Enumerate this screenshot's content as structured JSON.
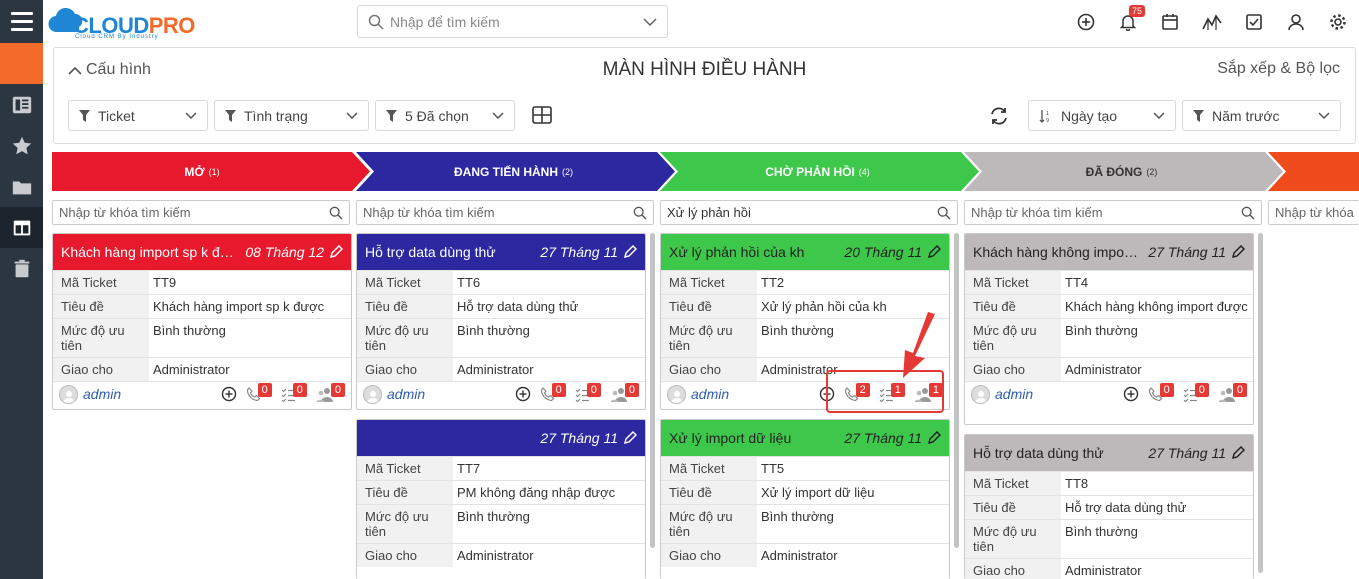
{
  "app": {
    "brand_cloud": "CLOUD",
    "brand_pro": "PRO",
    "tagline": "Cloud CRM By Industry",
    "search_placeholder": "Nhập để tìm kiếm",
    "notification_count": "75"
  },
  "config": {
    "config_label": "Cấu hình",
    "title": "MÀN HÌNH ĐIỀU HÀNH",
    "sort_filter_label": "Sắp xếp & Bộ lọc",
    "filters": {
      "module": "Ticket",
      "status": "Tình trạng",
      "selected": "5 Đã chọn",
      "sort_by": "Ngày tạo",
      "period": "Năm trước"
    }
  },
  "stages": [
    {
      "label": "MỞ",
      "count": "(1)",
      "color": "#e8192c"
    },
    {
      "label": "ĐANG TIẾN HÀNH",
      "count": "(2)",
      "color": "#2b28a0"
    },
    {
      "label": "CHỜ PHẢN HỒI",
      "count": "(4)",
      "color": "#3ec84b"
    },
    {
      "label": "ĐÃ ĐÓNG",
      "count": "(2)",
      "color": "#bdb8b9"
    },
    {
      "label": "",
      "count": "",
      "color": "#f04b1c"
    }
  ],
  "column_search": {
    "placeholder": "Nhập từ khóa tìm kiếm",
    "value_col3": "Xử lý phản hồi",
    "placeholder_col5": "Nhập từ khóa"
  },
  "field_labels": {
    "ticket_no": "Mã Ticket",
    "title": "Tiêu đề",
    "priority": "Mức độ ưu tiên",
    "assignee": "Giao cho"
  },
  "cards": {
    "c1": {
      "head": "Khách hàng import sp k đư...",
      "date": "08 Tháng 12",
      "ticket_no": "TT9",
      "title": "Khách hàng import sp k được",
      "priority": "Bình thường",
      "assignee": "Administrator",
      "user": "admin",
      "calls": "0",
      "tasks": "0",
      "contacts": "0"
    },
    "c2": {
      "head": "Hỗ trợ data dùng thử",
      "date": "27 Tháng 11",
      "ticket_no": "TT6",
      "title": "Hỗ trợ data dùng thử",
      "priority": "Bình thường",
      "assignee": "Administrator",
      "user": "admin",
      "calls": "0",
      "tasks": "0",
      "contacts": "0"
    },
    "c3": {
      "head": "",
      "date": "27 Tháng 11",
      "ticket_no": "TT7",
      "title": "PM không đăng nhập được",
      "priority": "Bình thường",
      "assignee": "Administrator"
    },
    "c4": {
      "head": "Xử lý phản hồi của kh",
      "date": "20 Tháng 11",
      "ticket_no": "TT2",
      "title": "Xử lý phản hồi của kh",
      "priority": "Bình thường",
      "assignee": "Administrator",
      "user": "admin",
      "calls": "2",
      "tasks": "1",
      "contacts": "1"
    },
    "c5": {
      "head": "Xử lý import dữ liệu",
      "date": "27 Tháng 11",
      "ticket_no": "TT5",
      "title": "Xử lý import dữ liệu",
      "priority": "Bình thường",
      "assignee": "Administrator"
    },
    "c6": {
      "head": "Khách hàng không import...",
      "date": "27 Tháng 11",
      "ticket_no": "TT4",
      "title": "Khách hàng không import được",
      "priority": "Bình thường",
      "assignee": "Administrator",
      "user": "admin",
      "calls": "0",
      "tasks": "0",
      "contacts": "0"
    },
    "c7": {
      "head": "Hỗ trợ data dùng thử",
      "date": "27 Tháng 11",
      "ticket_no": "TT8",
      "title": "Hỗ trợ data dùng thử",
      "priority": "Bình thường",
      "assignee": "Administrator"
    }
  },
  "colors": {
    "sidebar": "#2b3640",
    "accent_orange": "#f26b2a",
    "brand_blue": "#1e86d4",
    "badge_red": "#e53935",
    "closed_header": "#bdb8b9"
  }
}
